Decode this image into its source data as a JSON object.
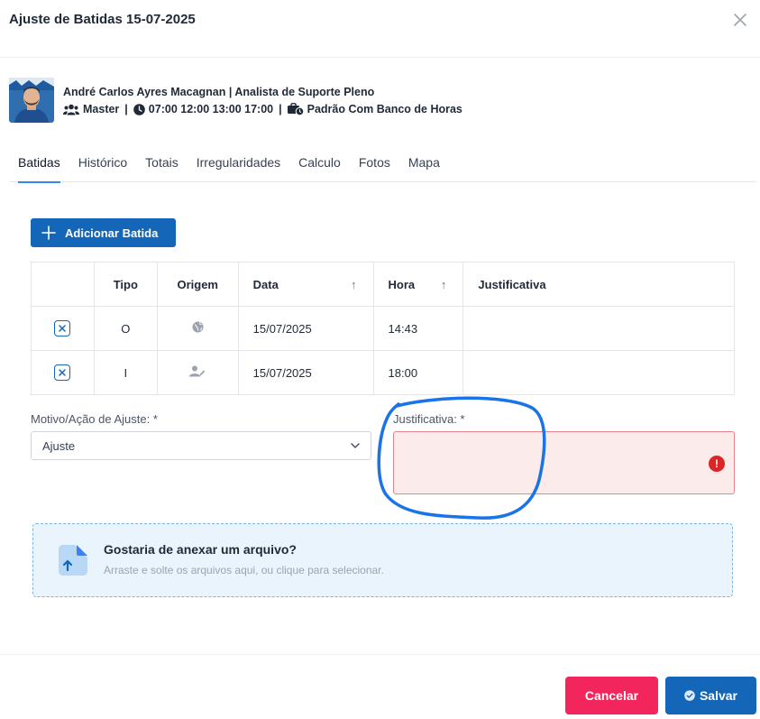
{
  "modal": {
    "title": "Ajuste de Batidas 15-07-2025"
  },
  "employee": {
    "name_role": "André Carlos Ayres Macagnan | Analista de Suporte Pleno",
    "group": "Master",
    "schedule": "07:00 12:00 13:00 17:00",
    "policy": "Padrão Com Banco de Horas",
    "separator": "|"
  },
  "tabs": [
    {
      "label": "Batidas",
      "active": true
    },
    {
      "label": "Histórico"
    },
    {
      "label": "Totais"
    },
    {
      "label": "Irregularidades"
    },
    {
      "label": "Calculo"
    },
    {
      "label": "Fotos"
    },
    {
      "label": "Mapa"
    }
  ],
  "add_button": {
    "label": "Adicionar Batida"
  },
  "table": {
    "headers": {
      "tipo": "Tipo",
      "origem": "Origem",
      "data": "Data",
      "hora": "Hora",
      "justificativa": "Justificativa"
    },
    "rows": [
      {
        "tipo": "O",
        "origem_icon": "globe-icon",
        "data": "15/07/2025",
        "hora": "14:43",
        "justificativa": ""
      },
      {
        "tipo": "I",
        "origem_icon": "user-edit-icon",
        "data": "15/07/2025",
        "hora": "18:00",
        "justificativa": ""
      }
    ]
  },
  "form": {
    "motivo_label": "Motivo/Ação de Ajuste: *",
    "motivo_value": "Ajuste",
    "justificativa_label": "Justificativa: *",
    "justificativa_value": ""
  },
  "dropzone": {
    "title": "Gostaria de anexar um arquivo?",
    "subtitle": "Arraste e solte os arquivos aqui, ou clique para selecionar."
  },
  "footer": {
    "cancel_label": "Cancelar",
    "save_label": "Salvar"
  },
  "colors": {
    "primary": "#1466b8",
    "danger": "#f2255c",
    "error_field": "#fbebeb",
    "annotation": "#1a73e8"
  }
}
